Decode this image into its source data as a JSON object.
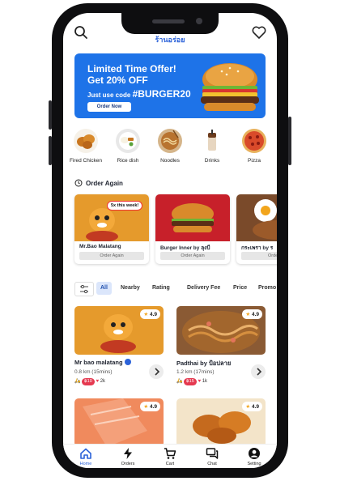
{
  "header": {
    "title": "ร้านอร่อย",
    "search_icon": "search-icon",
    "favorite_icon": "heart-icon"
  },
  "promo": {
    "headline": "Limited Time Offer!",
    "subheadline": "Get 20% OFF",
    "code_prefix": "Just use code",
    "code": "#BURGER20",
    "button_label": "Order Now",
    "background_color": "#1e73e8"
  },
  "categories": [
    {
      "label": "Fired Chicken"
    },
    {
      "label": "Rice dish"
    },
    {
      "label": "Noodles"
    },
    {
      "label": "Drinks"
    },
    {
      "label": "Pizza"
    }
  ],
  "order_again": {
    "title": "Order Again",
    "cards": [
      {
        "name": "Mr.Bao Malatang",
        "badge": "5x this week!",
        "button_label": "Order Again"
      },
      {
        "name": "Burger Inner by ลุงบี",
        "button_label": "Order Again"
      },
      {
        "name": "กระเพรา by ร",
        "button_label": "Order"
      }
    ]
  },
  "filters": {
    "items": [
      "All",
      "Nearby",
      "Rating",
      "Delivery Fee",
      "Price",
      "Promo"
    ],
    "active": "All"
  },
  "restaurants": [
    {
      "name": "Mr bao malatang",
      "rating": "4.9",
      "distance": "0.8 km (15mins)",
      "price_badge": "฿10",
      "likes": "2k",
      "verified": true
    },
    {
      "name": "Padthai by ป้อปลาย",
      "rating": "4.9",
      "distance": "1.2 km (17mins)",
      "price_badge": "฿15",
      "likes": "1k",
      "verified": false
    },
    {
      "name": "",
      "rating": "4.9"
    },
    {
      "name": "",
      "rating": "4.9"
    }
  ],
  "tabbar": {
    "items": [
      {
        "label": "Home",
        "icon": "home-icon"
      },
      {
        "label": "Orders",
        "icon": "bolt-icon"
      },
      {
        "label": "Cart",
        "icon": "cart-icon"
      },
      {
        "label": "Chat",
        "icon": "chat-icon"
      },
      {
        "label": "Setting",
        "icon": "user-icon"
      }
    ],
    "active": "Home",
    "accent_color": "#2b62d9"
  },
  "colors": {
    "accent": "#2b62d9",
    "price_badge": "#e53950",
    "card_orange": "#e59a2c"
  }
}
